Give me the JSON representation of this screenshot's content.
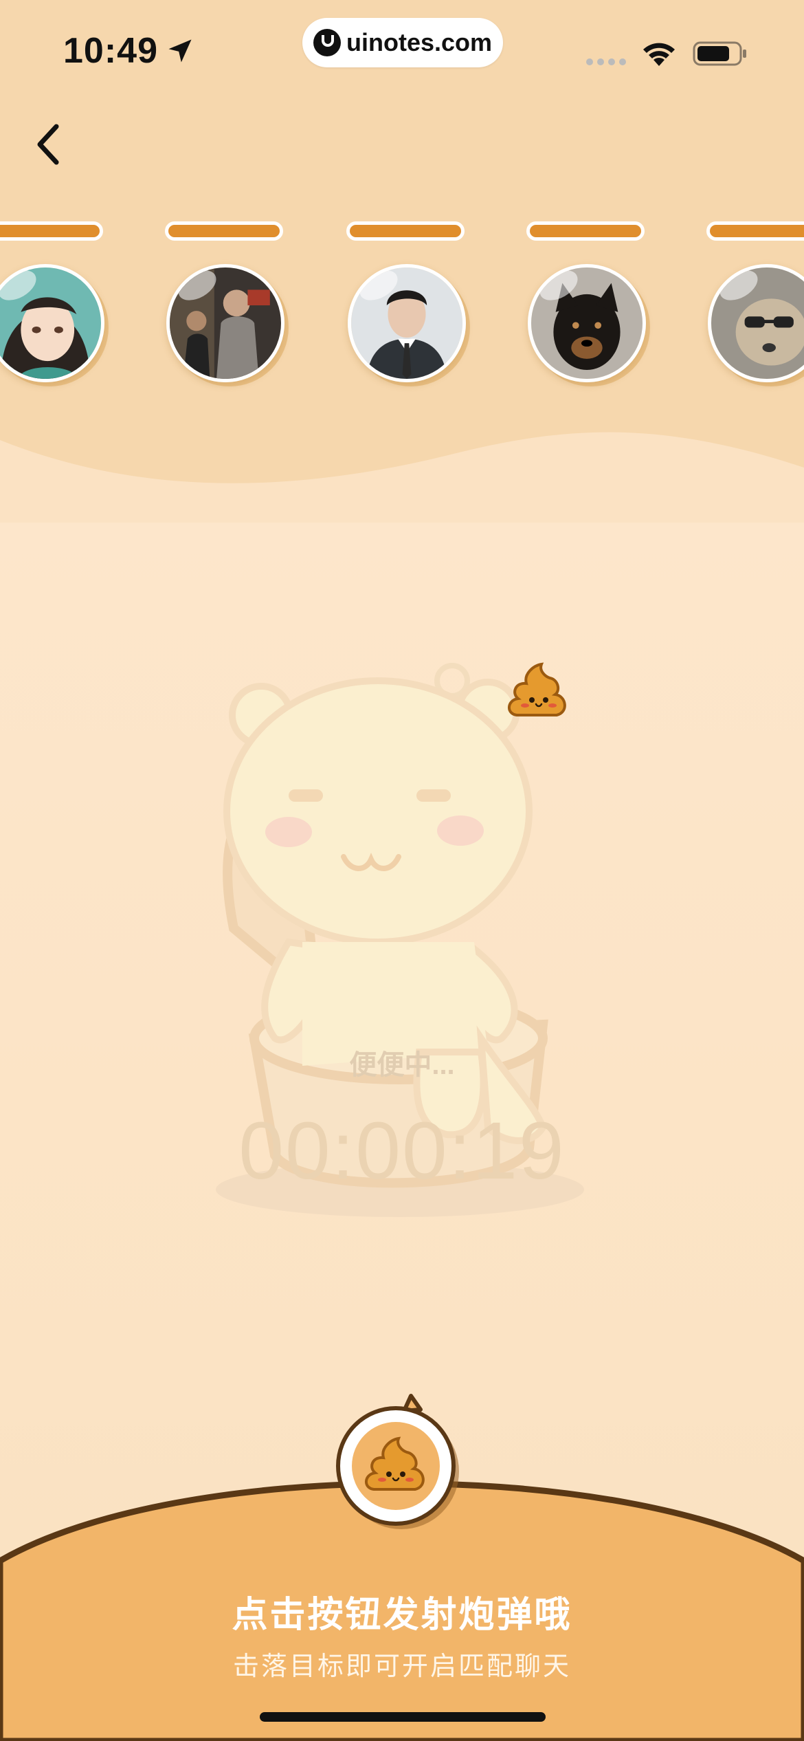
{
  "status_bar": {
    "time": "10:49",
    "url": "uinotes.com",
    "icons": [
      "location-arrow-icon",
      "signal-icon",
      "wifi-icon",
      "battery-icon"
    ]
  },
  "nav": {
    "back_icon": "chevron-left-icon"
  },
  "avatars": [
    {
      "name": "avatar-anime-girl",
      "kind": "illustrated portrait"
    },
    {
      "name": "avatar-street-photo",
      "kind": "photo"
    },
    {
      "name": "avatar-man-in-suit",
      "kind": "photo"
    },
    {
      "name": "avatar-black-dog",
      "kind": "photo"
    },
    {
      "name": "avatar-dog-sunglasses",
      "kind": "photo"
    }
  ],
  "main": {
    "status_text": "便便中...",
    "timer": "00:00:19"
  },
  "bottom": {
    "button_icon": "poop-icon",
    "title": "点击按钮发射炮弹哦",
    "subtitle": "击落目标即可开启匹配聊天"
  },
  "colors": {
    "accent": "#e08e2c",
    "top_band": "#f6d7ad",
    "background": "#fde7cc",
    "bottom_panel": "#f2b569",
    "outline": "#5a3815"
  }
}
